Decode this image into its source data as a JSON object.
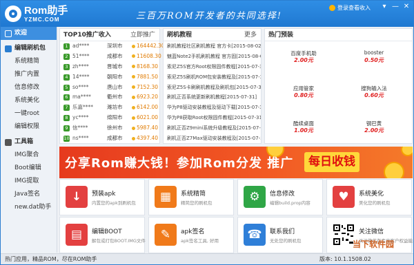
{
  "header": {
    "logo_name": "Rom助手",
    "logo_site": "YZMC.COM",
    "slogan": "三百万ROM开发者的共同选择!",
    "login_text": "登录查看收入",
    "win_buttons": [
      "▾",
      "—",
      "✕"
    ]
  },
  "sidebar": {
    "items": [
      {
        "label": "欢迎",
        "kind": "group",
        "active": true,
        "icon": "home-icon"
      },
      {
        "label": "编辑刷机包",
        "kind": "group",
        "active": false,
        "icon": "flash-package-icon"
      },
      {
        "label": "系统精简",
        "kind": "sub"
      },
      {
        "label": "推广内置",
        "kind": "sub"
      },
      {
        "label": "信息修改",
        "kind": "sub"
      },
      {
        "label": "系统美化",
        "kind": "sub"
      },
      {
        "label": "一键root",
        "kind": "sub"
      },
      {
        "label": "编辑权限",
        "kind": "sub"
      },
      {
        "label": "工具箱",
        "kind": "group",
        "active": false,
        "icon": "toolbox-icon"
      },
      {
        "label": "IMG聚合",
        "kind": "sub"
      },
      {
        "label": "Boot编辑",
        "kind": "sub"
      },
      {
        "label": "IMG提取",
        "kind": "sub"
      },
      {
        "label": "Java签名",
        "kind": "sub"
      },
      {
        "label": "new.dat助手",
        "kind": "sub"
      }
    ]
  },
  "top_rank": {
    "title": "TOP10推广收入",
    "more": "立即推广",
    "rows": [
      {
        "rank": "1",
        "user": "ad****",
        "city": "深圳市",
        "score": "164442.30"
      },
      {
        "rank": "2",
        "user": "51****",
        "city": "成都市",
        "score": "11608.30"
      },
      {
        "rank": "3",
        "user": "zh****",
        "city": "晋城市",
        "score": "8168.30"
      },
      {
        "rank": "4",
        "user": "14****",
        "city": "朝阳市",
        "score": "7881.50"
      },
      {
        "rank": "5",
        "user": "so****",
        "city": "唐山市",
        "score": "7152.30"
      },
      {
        "rank": "6",
        "user": "ma****",
        "city": "衢州市",
        "score": "6923.20"
      },
      {
        "rank": "7",
        "user": "乐嘉****",
        "city": "潍坊市",
        "score": "6142.00"
      },
      {
        "rank": "8",
        "user": "yc****",
        "city": "绵阳市",
        "score": "6021.00"
      },
      {
        "rank": "9",
        "user": "信****",
        "city": "徐州市",
        "score": "5987.40"
      },
      {
        "rank": "10",
        "user": "ns****",
        "city": "成都市",
        "score": "4397.40"
      }
    ]
  },
  "flash_tutorial": {
    "title": "刷机教程",
    "more": "更多",
    "rows": [
      "刷机教程社区刷机教程 官方卡[2015-08-02]",
      "魅蓝Note2手机刷机教程 官方固[2015-08-02]",
      "索尼Z5S官方Root权限固件教程[2015-07-30]",
      "索尼Z5S刷机ROM包安装教程及[2015-07-30]",
      "索尼Z5S卡刷刷机教程及刷机包[2015-07-30]",
      "刷机正否系统更新刷机教程[2015-07-31]",
      "华为P8驱动安装教程及驱动下载[2015-07-31]",
      "华为P8获取Root权限固件教程[2015-07-31]",
      "刷机正否Z9mini系统升级教程及[2015-07-31]",
      "刷机正否Z7Max驱动安装教程及[2015-07-31]"
    ]
  },
  "presets": {
    "title": "热门预装",
    "items": [
      {
        "name": "百度手机助",
        "price": "2.00元"
      },
      {
        "name": "booster",
        "price": "0.50元"
      },
      {
        "name": "应用管家",
        "price": "0.80元"
      },
      {
        "name": "搜狗输入法",
        "price": "0.60元"
      },
      {
        "name": "酷续桌面",
        "price": "1.00元"
      },
      {
        "name": "钢巴黄",
        "price": "2.00元"
      }
    ]
  },
  "banner": {
    "text": "分享Rom赚大钱！参加Rom分发 推广",
    "badge": "每日收钱"
  },
  "tiles": [
    {
      "title": "预装apk",
      "desc": "内置您的apk到刷机包",
      "icon": "download-icon",
      "glyph": "↓",
      "color": "#e34040"
    },
    {
      "title": "系统精简",
      "desc": "精简您的刷机包",
      "icon": "trash-icon",
      "glyph": "▦",
      "color": "#f07a1a"
    },
    {
      "title": "信息修改",
      "desc": "编辑build.prop内容",
      "icon": "info-edit-icon",
      "glyph": "⚙",
      "color": "#2fa646"
    },
    {
      "title": "系统美化",
      "desc": "美化您的刷机包",
      "icon": "heart-icon",
      "glyph": "♥",
      "color": "#e34040"
    },
    {
      "title": "编辑BOOT",
      "desc": "解包或打包BOOT.IMG文件",
      "icon": "boot-edit-icon",
      "glyph": "▤",
      "color": "#e34040"
    },
    {
      "title": "apk签名",
      "desc": "apk签名工具, 好用",
      "icon": "pencil-icon",
      "glyph": "✎",
      "color": "#f07a1a"
    },
    {
      "title": "联系我们",
      "desc": "无处您的刷机包",
      "icon": "contact-icon",
      "glyph": "☎",
      "color": "#2f7fd8"
    },
    {
      "title": "关注微信",
      "desc": "关注微信有专享客户权益能...",
      "icon": "qr-code-icon",
      "glyph": "",
      "color": "#ffffff"
    }
  ],
  "footer": {
    "left": "热门应用，精品ROM，尽在ROM助手",
    "version": "版本: 10.1.1508.02"
  },
  "watermark": "当下软件园"
}
